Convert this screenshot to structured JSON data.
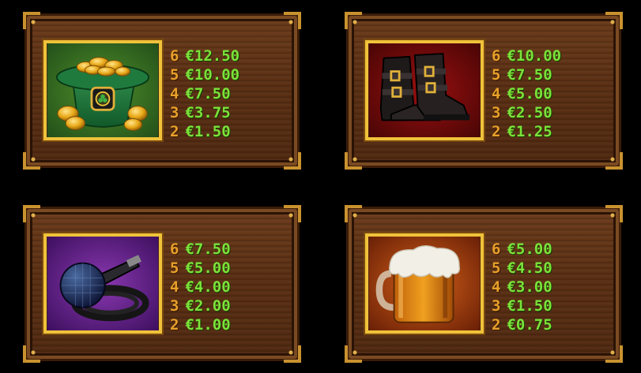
{
  "colors": {
    "background": "#000000",
    "count": "#e8a02a",
    "amount": "#7be23a",
    "frame": "#f0c23a"
  },
  "panels": [
    {
      "symbol": "leprechaun-hat-gold-coins-icon",
      "pays": [
        {
          "count": "6",
          "amount": "€12.50"
        },
        {
          "count": "5",
          "amount": "€10.00"
        },
        {
          "count": "4",
          "amount": "€7.50"
        },
        {
          "count": "3",
          "amount": "€3.75"
        },
        {
          "count": "2",
          "amount": "€1.50"
        }
      ]
    },
    {
      "symbol": "black-boots-icon",
      "pays": [
        {
          "count": "6",
          "amount": "€10.00"
        },
        {
          "count": "5",
          "amount": "€7.50"
        },
        {
          "count": "4",
          "amount": "€5.00"
        },
        {
          "count": "3",
          "amount": "€2.50"
        },
        {
          "count": "2",
          "amount": "€1.25"
        }
      ]
    },
    {
      "symbol": "microphone-icon",
      "pays": [
        {
          "count": "6",
          "amount": "€7.50"
        },
        {
          "count": "5",
          "amount": "€5.00"
        },
        {
          "count": "4",
          "amount": "€4.00"
        },
        {
          "count": "3",
          "amount": "€2.00"
        },
        {
          "count": "2",
          "amount": "€1.00"
        }
      ]
    },
    {
      "symbol": "beer-mug-icon",
      "pays": [
        {
          "count": "6",
          "amount": "€5.00"
        },
        {
          "count": "5",
          "amount": "€4.50"
        },
        {
          "count": "4",
          "amount": "€3.00"
        },
        {
          "count": "3",
          "amount": "€1.50"
        },
        {
          "count": "2",
          "amount": "€0.75"
        }
      ]
    }
  ]
}
